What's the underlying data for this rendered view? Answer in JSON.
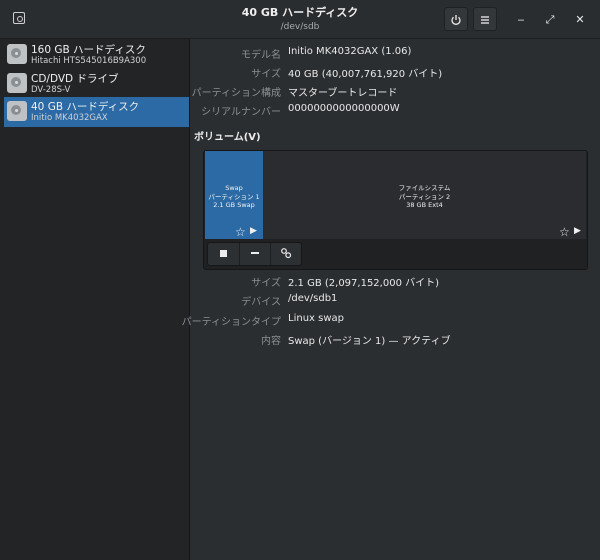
{
  "header": {
    "title": "40 GB ハードディスク",
    "subtitle": "/dev/sdb",
    "power_icon": "power-icon",
    "menu_icon": "menu-icon",
    "minimize_glyph": "‒",
    "maximize_glyph": "⤢",
    "close_glyph": "✕"
  },
  "sidebar": {
    "drives": [
      {
        "name": "160 GB ハードディスク",
        "model": "Hitachi HTS545016B9A300",
        "selected": false
      },
      {
        "name": "CD/DVD ドライブ",
        "model": "DV-28S-V",
        "selected": false
      },
      {
        "name": "40 GB ハードディスク",
        "model": "Initio MK4032GAX",
        "selected": true
      }
    ]
  },
  "drive_info": {
    "model_label": "モデル名",
    "model_value": "Initio MK4032GAX (1.06)",
    "size_label": "サイズ",
    "size_value": "40 GB (40,007,761,920 バイト)",
    "partitioning_label": "パーティション構成",
    "partitioning_value": "マスターブートレコード",
    "serial_label": "シリアルナンバー",
    "serial_value": "0000000000000000W"
  },
  "volumes": {
    "title": "ボリューム(V)",
    "partitions": [
      {
        "line1": "Swap",
        "line2": "パーティション 1",
        "line3": "2.1 GB Swap",
        "selected": true
      },
      {
        "line1": "ファイルシステム",
        "line2": "パーティション 2",
        "line3": "38 GB Ext4",
        "selected": false
      }
    ],
    "star_glyph": "☆",
    "play_glyph": "▶"
  },
  "toolbar": {
    "stop_icon": "stop-icon",
    "minus_icon": "minus-icon",
    "settings_icon": "gears-icon"
  },
  "partition_info": {
    "size_label": "サイズ",
    "size_value": "2.1 GB (2,097,152,000 バイト)",
    "device_label": "デバイス",
    "device_value": "/dev/sdb1",
    "type_label": "パーティションタイプ",
    "type_value": "Linux swap",
    "contents_label": "内容",
    "contents_value": "Swap (バージョン 1) — アクティブ"
  },
  "colors": {
    "accent": "#2c6aa6",
    "background": "#2b2e31",
    "sidebar": "#222426"
  }
}
